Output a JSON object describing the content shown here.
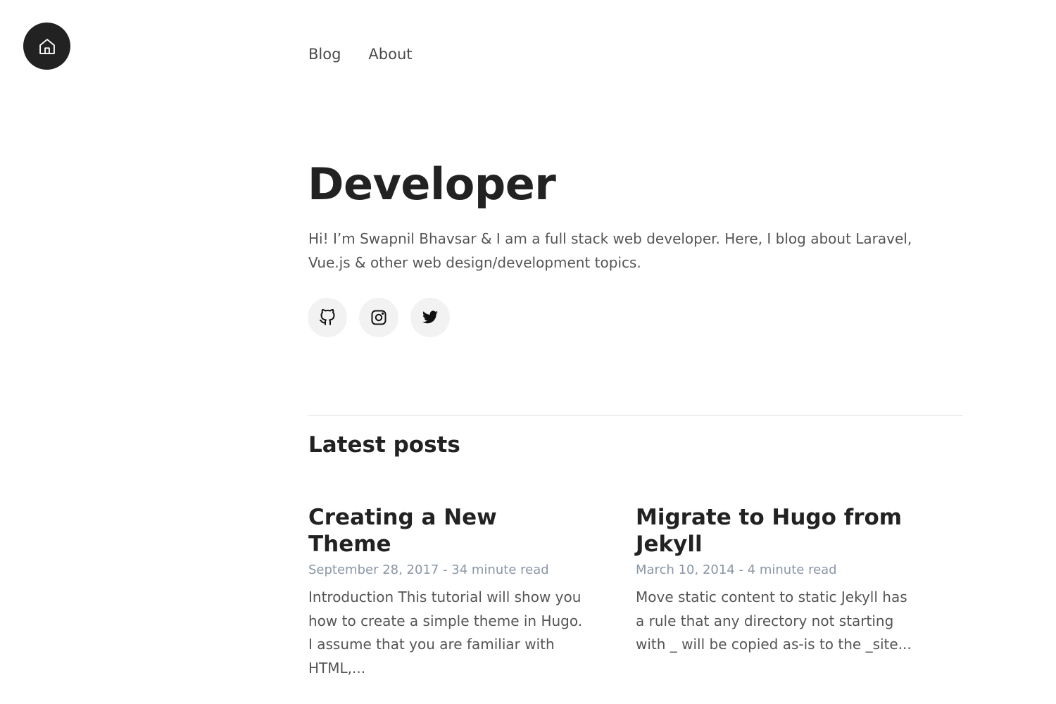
{
  "header": {
    "home_icon": "home-icon",
    "nav": [
      {
        "label": "Blog"
      },
      {
        "label": "About"
      }
    ]
  },
  "hero": {
    "title": "Developer",
    "bio": "Hi! I’m Swapnil Bhavsar & I am a full stack web developer. Here, I blog about Laravel, Vue.js & other web design/development topics.",
    "socials": [
      {
        "icon": "github-icon"
      },
      {
        "icon": "instagram-icon"
      },
      {
        "icon": "twitter-icon"
      }
    ]
  },
  "latest": {
    "title": "Latest posts",
    "posts": [
      {
        "title": "Creating a New Theme",
        "meta": "September 28, 2017 - 34 minute read",
        "excerpt": "Introduction This tutorial will show you how to create a simple theme in Hugo. I assume that you are familiar with HTML,..."
      },
      {
        "title": "Migrate to Hugo from Jekyll",
        "meta": "March 10, 2014 - 4 minute read",
        "excerpt": "Move static content to static Jekyll has a rule that any directory not starting with _ will be copied as-is to the _site..."
      }
    ]
  },
  "colors": {
    "text_dark": "#222222",
    "text_body": "#555555",
    "meta": "#8a96a6",
    "social_bg": "#f2f2f2"
  }
}
